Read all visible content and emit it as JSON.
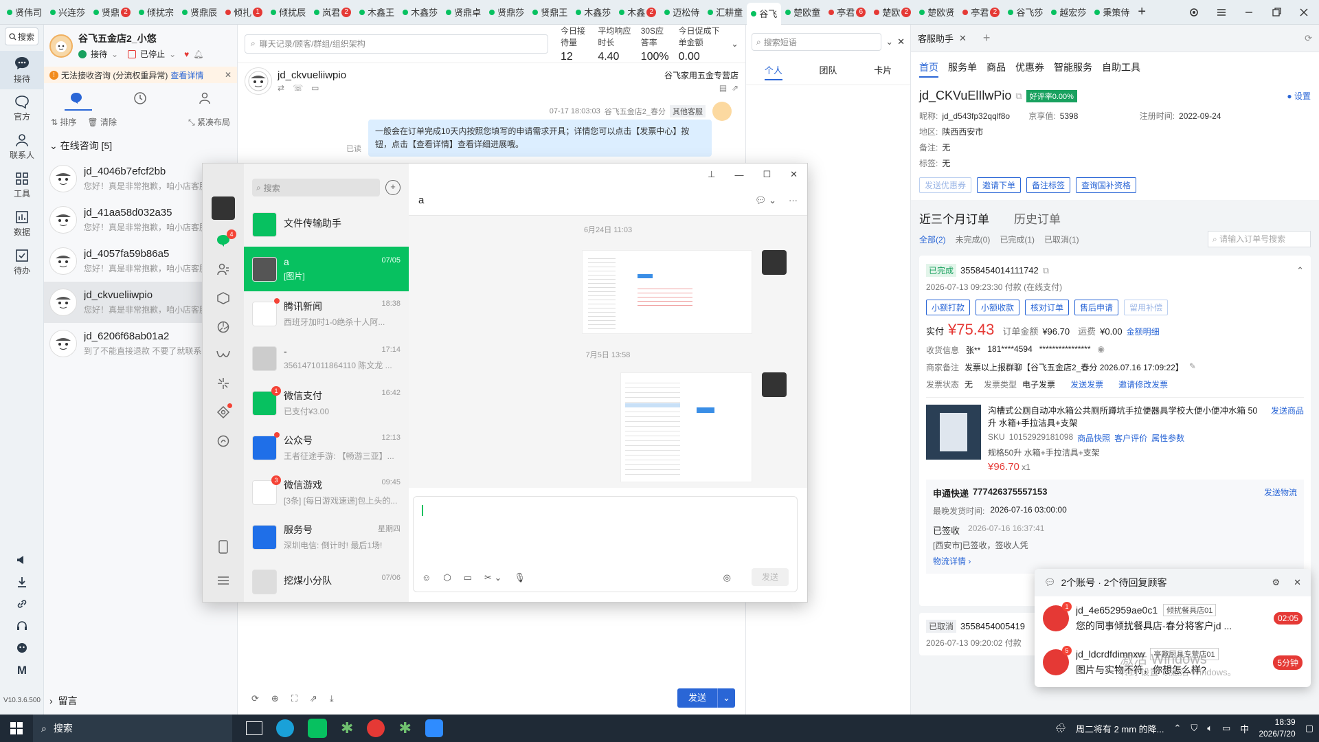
{
  "tabs": [
    {
      "label": "贤伟司",
      "dot": "#07c160",
      "badge": ""
    },
    {
      "label": "兴连莎",
      "dot": "#07c160",
      "badge": ""
    },
    {
      "label": "贤鼎",
      "dot": "#07c160",
      "badge": "2"
    },
    {
      "label": "倾扰宗",
      "dot": "#07c160",
      "badge": ""
    },
    {
      "label": "贤鼎辰",
      "dot": "#07c160",
      "badge": ""
    },
    {
      "label": "倾扎",
      "dot": "#e53935",
      "badge": "1"
    },
    {
      "label": "倾扰辰",
      "dot": "#07c160",
      "badge": ""
    },
    {
      "label": "岚君",
      "dot": "#07c160",
      "badge": "2"
    },
    {
      "label": "木鑫王",
      "dot": "#07c160",
      "badge": ""
    },
    {
      "label": "木鑫莎",
      "dot": "#07c160",
      "badge": ""
    },
    {
      "label": "贤鼎卓",
      "dot": "#07c160",
      "badge": ""
    },
    {
      "label": "贤鼎莎",
      "dot": "#07c160",
      "badge": ""
    },
    {
      "label": "贤鼎王",
      "dot": "#07c160",
      "badge": ""
    },
    {
      "label": "木鑫莎",
      "dot": "#07c160",
      "badge": ""
    },
    {
      "label": "木鑫",
      "dot": "#07c160",
      "badge": "2"
    },
    {
      "label": "迈松侍",
      "dot": "#07c160",
      "badge": ""
    },
    {
      "label": "汇耕童",
      "dot": "#07c160",
      "badge": ""
    },
    {
      "label": "谷飞",
      "dot": "#07c160",
      "badge": ""
    },
    {
      "label": "楚欧童",
      "dot": "#07c160",
      "badge": ""
    },
    {
      "label": "亭君",
      "dot": "#e53935",
      "badge": "6"
    },
    {
      "label": "楚欧",
      "dot": "#e53935",
      "badge": "2"
    },
    {
      "label": "楚欧贤",
      "dot": "#07c160",
      "badge": ""
    },
    {
      "label": "亭君",
      "dot": "#e53935",
      "badge": "2"
    },
    {
      "label": "谷飞莎",
      "dot": "#07c160",
      "badge": ""
    },
    {
      "label": "越宏莎",
      "dot": "#07c160",
      "badge": ""
    },
    {
      "label": "秉策侍",
      "dot": "#07c160",
      "badge": ""
    }
  ],
  "rail": {
    "search": "搜索",
    "items": [
      "接待",
      "官方",
      "联系人",
      "工具",
      "数据",
      "待办"
    ],
    "version": "V10.3.6.500"
  },
  "shop": {
    "name": "谷飞五金店2_小悠",
    "status1": "接待",
    "status2": "已停止",
    "warning": "无法接收咨询 (分流权重异常)",
    "warning_link": "查看详情",
    "sort": "排序",
    "clear": "清除",
    "layout": "紧凑布局",
    "group": "在线咨询 [5]",
    "leave_msg": "留言"
  },
  "convs": [
    {
      "name": "jd_4046b7efcf2bb",
      "preview": "您好！真是非常抱歉，咱小店客服"
    },
    {
      "name": "jd_41aa58d032a35",
      "preview": "您好！真是非常抱歉，咱小店客服"
    },
    {
      "name": "jd_4057fa59b86a5",
      "preview": "您好！真是非常抱歉，咱小店客服"
    },
    {
      "name": "jd_ckvueliiwpio",
      "preview": "您好！真是非常抱歉，咱小店客服"
    },
    {
      "name": "jd_6206f68ab01a2",
      "preview": "到了不能直接退款 不要了就联系"
    }
  ],
  "chat": {
    "search_placeholder": "聊天记录/顾客/群组/组织架构",
    "stats": [
      {
        "label": "今日接待量",
        "value": "12"
      },
      {
        "label": "平均响应时长",
        "value": "4.40"
      },
      {
        "label": "30S应答率",
        "value": "100%"
      },
      {
        "label": "今日促成下单金额",
        "value": "0.00"
      }
    ],
    "customer": "jd_ckvueliiwpio",
    "shop_tag": "谷飞家用五金专营店",
    "msg_time": "07-17 18:03:03",
    "msg_from": "谷飞五金店2_春分",
    "msg_role": "其他客服",
    "msg_text": "一般会在订单完成10天内按照您填写的申请需求开具；详情您可以点击【发票中心】按钮，点击【查看详情】查看详细进展哦。",
    "msg_read": "已读",
    "send": "发送"
  },
  "helper": {
    "search_placeholder": "搜索短语",
    "tabs": [
      "个人",
      "团队",
      "卡片"
    ]
  },
  "assistant": {
    "title": "客服助手",
    "nav": [
      "首页",
      "服务单",
      "商品",
      "优惠券",
      "智能服务",
      "自助工具"
    ],
    "user": "jd_CKVuElIlwPio",
    "rate": "好评率0.00%",
    "settings": "设置",
    "nick_label": "昵称:",
    "nick": "jd_d543fp32qqlf8o",
    "jx_label": "京享值:",
    "jx": "5398",
    "reg_label": "注册时间:",
    "reg": "2022-09-24",
    "area_label": "地区:",
    "area": "陕西西安市",
    "remark_label": "备注:",
    "remark": "无",
    "tag_label": "标签:",
    "tag": "无",
    "btns": [
      "发送优惠券",
      "邀请下单",
      "备注标签",
      "查询国补资格"
    ],
    "order_tabs": [
      "近三个月订单",
      "历史订单"
    ],
    "order_filter": [
      "全部(2)",
      "未完成(0)",
      "已完成(1)",
      "已取消(1)"
    ],
    "order_search": "请输入订单号搜索",
    "order1": {
      "status": "已完成",
      "id": "3558454014111742",
      "time": "2026-07-13 09:23:30 付款 (在线支付)",
      "actions": [
        "小额打款",
        "小额收款",
        "核对订单",
        "售后申请",
        "留用补偿"
      ],
      "paid_label": "实付",
      "paid": "¥75.43",
      "total_label": "订单金额",
      "total": "¥96.70",
      "ship_label": "运费",
      "ship": "¥0.00",
      "detail": "金额明细",
      "recv_label": "收货信息",
      "recv_name": "张**",
      "recv_phone": "181****4594",
      "recv_addr": "****************",
      "merchant_note_label": "商家备注",
      "merchant_note": "发票以上报群聊【谷飞五金店2_春分 2026.07.16 17:09:22】",
      "invoice_label": "发票状态",
      "invoice": "无",
      "invoice_type_label": "发票类型",
      "invoice_type": "电子发票",
      "send_invoice": "发送发票",
      "invite_invoice": "邀请修改发票"
    },
    "product": {
      "name": "沟槽式公厕自动冲水箱公共厕所蹲坑手拉便器具学校大便小便冲水箱 50升 水箱+手拉洁具+支架",
      "sku_label": "SKU",
      "sku": "10152929181098",
      "snap": "商品快照",
      "review": "客户评价",
      "attr": "属性参数",
      "spec": "规格50升 水箱+手拉洁具+支架",
      "price": "¥96.70",
      "qty": "x1",
      "send": "发送商品"
    },
    "logistics": {
      "company": "申通快递",
      "no": "777426375557153",
      "latest_label": "最晚发货时间:",
      "latest": "2026-07-16 03:00:00",
      "signed": "已签收",
      "signed_time": "2026-07-16 16:37:41",
      "signed_desc": "[西安市]已签收，签收人凭",
      "detail": "物流详情",
      "send": "发送物流"
    },
    "order2": {
      "status": "已取消",
      "id": "3558454005419",
      "time": "2026-07-13 09:20:02 付款"
    }
  },
  "popup": {
    "title": "2个账号 · 2个待回复顾客",
    "items": [
      {
        "name": "jd_4e652959ae0c1",
        "shop": "倾扰餐具店01",
        "text": "您的同事倾扰餐具店-春分将客户jd ...",
        "time": "02:05",
        "badge": "1"
      },
      {
        "name": "jd_ldcrdfdimnxw",
        "shop": "亭趣厨具专营店01",
        "text": "图片与实物不符，你想怎么样?",
        "time": "5分钟",
        "badge": "5"
      }
    ],
    "watermark": "激活 Windows",
    "watermark2": "转到\"设置\"以激活 Windows。"
  },
  "wechat": {
    "search": "搜索",
    "chat_title": "a",
    "date1": "6月24日 11:03",
    "date2": "7月5日 13:58",
    "send": "发送",
    "list": [
      {
        "name": "文件传输助手",
        "time": "",
        "preview": "",
        "color": "#07c160",
        "badge": ""
      },
      {
        "name": "a",
        "time": "07/05",
        "preview": "[图片]",
        "color": "#555",
        "badge": ""
      },
      {
        "name": "腾讯新闻",
        "time": "18:38",
        "preview": "西班牙加时1-0绝杀十人阿...",
        "color": "#fff",
        "badge": "•"
      },
      {
        "name": "-",
        "time": "17:14",
        "preview": "3561471011864110 陈文龙 ...",
        "color": "#ccc",
        "badge": ""
      },
      {
        "name": "微信支付",
        "time": "16:42",
        "preview": "已支付¥3.00",
        "color": "#07c160",
        "badge": "1"
      },
      {
        "name": "公众号",
        "time": "12:13",
        "preview": "王者征途手游: 【畅游三亚】...",
        "color": "#1f6fe8",
        "badge": "•"
      },
      {
        "name": "微信游戏",
        "time": "09:45",
        "preview": "[3条] [每日游戏速递]包上头的...",
        "color": "#fff",
        "badge": "3"
      },
      {
        "name": "服务号",
        "time": "星期四",
        "preview": "深圳电信: 倒计时! 最后1场!",
        "color": "#1f6fe8",
        "badge": ""
      },
      {
        "name": "挖煤小分队",
        "time": "07/06",
        "preview": "",
        "color": "#ddd",
        "badge": ""
      }
    ]
  },
  "taskbar": {
    "search": "搜索",
    "weather": "周二将有 2 mm 的降...",
    "ime": "中",
    "time": "18:39",
    "date": "2026/7/20"
  }
}
